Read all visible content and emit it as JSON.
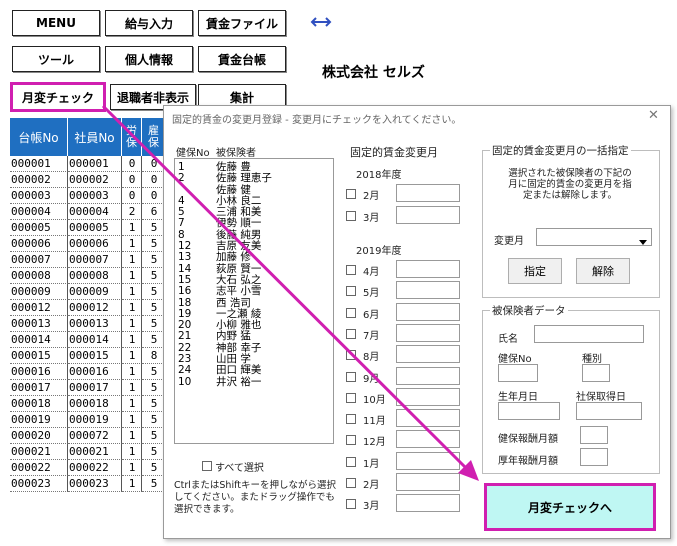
{
  "menu": {
    "row1": [
      "MENU",
      "給与入力",
      "賃金ファイル"
    ],
    "row2": [
      "ツール",
      "個人情報",
      "賃金台帳"
    ],
    "row3": [
      "月変チェック",
      "退職者非表示",
      "集計"
    ]
  },
  "company_name": "株式会社 セルズ",
  "sheet_table": {
    "headers": [
      "台帳No",
      "社員No",
      "労保",
      "雇保"
    ],
    "rows": [
      [
        "000001",
        "000001",
        "0",
        "0"
      ],
      [
        "000002",
        "000002",
        "0",
        "0"
      ],
      [
        "000003",
        "000003",
        "0",
        "0"
      ],
      [
        "000004",
        "000004",
        "2",
        "6"
      ],
      [
        "000005",
        "000005",
        "1",
        "5"
      ],
      [
        "000006",
        "000006",
        "1",
        "5"
      ],
      [
        "000007",
        "000007",
        "1",
        "5"
      ],
      [
        "000008",
        "000008",
        "1",
        "5"
      ],
      [
        "000009",
        "000009",
        "1",
        "5"
      ],
      [
        "000012",
        "000012",
        "1",
        "5"
      ],
      [
        "000013",
        "000013",
        "1",
        "5"
      ],
      [
        "000014",
        "000014",
        "1",
        "5"
      ],
      [
        "000015",
        "000015",
        "1",
        "8"
      ],
      [
        "000016",
        "000016",
        "1",
        "5"
      ],
      [
        "000017",
        "000017",
        "1",
        "5"
      ],
      [
        "000018",
        "000018",
        "1",
        "5"
      ],
      [
        "000019",
        "000019",
        "1",
        "5"
      ],
      [
        "000020",
        "000072",
        "1",
        "5"
      ],
      [
        "000021",
        "000021",
        "1",
        "5"
      ],
      [
        "000022",
        "000022",
        "1",
        "5"
      ],
      [
        "000023",
        "000023",
        "1",
        "5"
      ]
    ]
  },
  "dialog": {
    "title": "固定的賃金の変更月登録 - 変更月にチェックを入れてください。",
    "close": "✕",
    "list_header_no": "健保No",
    "list_header_name": "被保険者",
    "list_items": [
      {
        "no": "1",
        "name": "佐藤 豊"
      },
      {
        "no": "2",
        "name": "佐藤 理恵子"
      },
      {
        "no": "",
        "name": "佐藤 健"
      },
      {
        "no": "4",
        "name": "小林 良二"
      },
      {
        "no": "5",
        "name": "三浦 和美"
      },
      {
        "no": "7",
        "name": "伊勢 順一"
      },
      {
        "no": "8",
        "name": "後藤 純男"
      },
      {
        "no": "12",
        "name": "吉原 友美"
      },
      {
        "no": "13",
        "name": "加藤 修"
      },
      {
        "no": "14",
        "name": "荻原 賢一"
      },
      {
        "no": "15",
        "name": "大石 弘之"
      },
      {
        "no": "16",
        "name": "志平 小雪"
      },
      {
        "no": "18",
        "name": "西 浩司"
      },
      {
        "no": "19",
        "name": "一之瀬 綾"
      },
      {
        "no": "20",
        "name": "小柳 雅也"
      },
      {
        "no": "21",
        "name": "内野 猛"
      },
      {
        "no": "22",
        "name": "神部 幸子"
      },
      {
        "no": "23",
        "name": "山田 学"
      },
      {
        "no": "24",
        "name": "田口 輝美"
      },
      {
        "no": "10",
        "name": "井沢 裕一"
      }
    ],
    "select_all_label": "すべて選択",
    "hint_text": "CtrlまたはShiftキーを押しながら選択してください。またドラッグ操作でも選択できます。",
    "months_title": "固定的賃金変更月",
    "year1": "2018年度",
    "year1_months": [
      "2月",
      "3月"
    ],
    "year2": "2019年度",
    "year2_months": [
      "4月",
      "5月",
      "6月",
      "7月",
      "8月",
      "9月",
      "10月",
      "11月",
      "12月",
      "1月",
      "2月",
      "3月"
    ],
    "bulk_group_title": "固定的賃金変更月の一括指定",
    "bulk_desc": "選択された被保険者の下記の月に固定的賃金の変更月を指定または解除します。",
    "change_month_label": "変更月",
    "change_month_value": "",
    "assign_button": "指定",
    "clear_button": "解除",
    "person_group_title": "被保険者データ",
    "name_label": "氏名",
    "kenpo_label": "健保No",
    "kind_label": "種別",
    "birth_label": "生年月日",
    "acq_label": "社保取得日",
    "kenpo_salary_label": "健保報酬月額",
    "kosei_salary_label": "厚年報酬月額",
    "go_button": "月変チェックへ"
  },
  "colors": {
    "highlight": "#d01fb0",
    "table_header": "#1f6fc1",
    "go_button_bg": "#bff7f3"
  },
  "icons": {
    "back_forward": "double-arrow-icon",
    "dropdown": "chevron-down-icon"
  }
}
